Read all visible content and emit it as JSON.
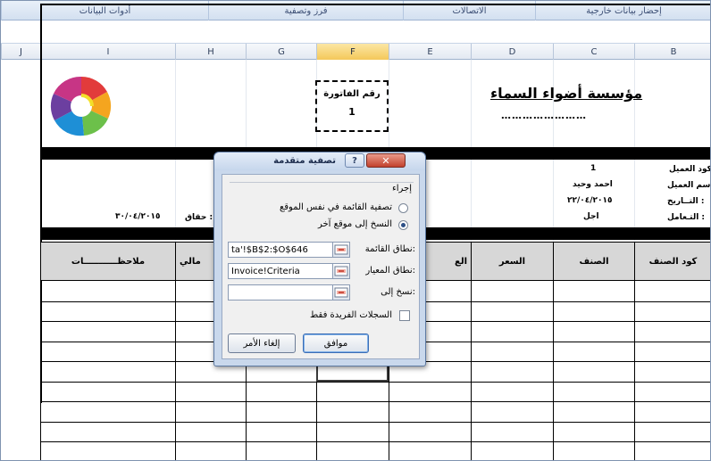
{
  "ribbon": {
    "groups": [
      {
        "label": "إحضار بيانات خارجية"
      },
      {
        "label": "الاتصالات"
      },
      {
        "label": "فرز وتصفية"
      },
      {
        "label": "أدوات البيانات"
      }
    ]
  },
  "columns": [
    "B",
    "C",
    "D",
    "E",
    "F",
    "G",
    "H",
    "I",
    "J"
  ],
  "selected_column": "F",
  "invoice": {
    "company_name": "مؤسسة أضواء السماء",
    "company_dots": "……………………",
    "invoice_number_label": "رقم الفاتورة",
    "invoice_number": "1",
    "customer_code_label": "كود العميل :",
    "customer_code": "1",
    "customer_name_label": "اسم العميل :",
    "customer_name": "احمد وحيد",
    "date_label": "التــاريخ :",
    "date": "٢٢/٠٤/٢٠١٥",
    "dealing_label": "التـعامل :",
    "dealing": "اجل",
    "due_label": "حقاق :",
    "due_date": "٣٠/٠٤/٢٠١٥"
  },
  "table": {
    "headers": [
      "كود الصنف",
      "الصنف",
      "السعر",
      "الع",
      "",
      "مالي",
      "ملاحظـــــــــــات"
    ]
  },
  "dialog": {
    "title": "تصفية متقدمة",
    "help": "?",
    "close": "✕",
    "action_label": "إجراء",
    "option_in_place": "تصفية القائمة في نفس الموقع",
    "option_copy": "النسخ إلى موقع آخر",
    "list_range_label": "نطاق القائمة:",
    "list_range_value": "ta'!$B$2:$O$646",
    "criteria_range_label": "نطاق المعيار:",
    "criteria_range_value": "Invoice!Criteria",
    "copy_to_label": "نسخ إلى:",
    "copy_to_value": "",
    "unique_label": "السجلات الفريدة فقط",
    "ok_label": "موافق",
    "cancel_label": "إلغاء الأمر"
  },
  "colors": {
    "logo": [
      "#e23b3b",
      "#f4a51f",
      "#f3e02a",
      "#6cc04a",
      "#1e8fd6",
      "#6c3fa0"
    ]
  }
}
